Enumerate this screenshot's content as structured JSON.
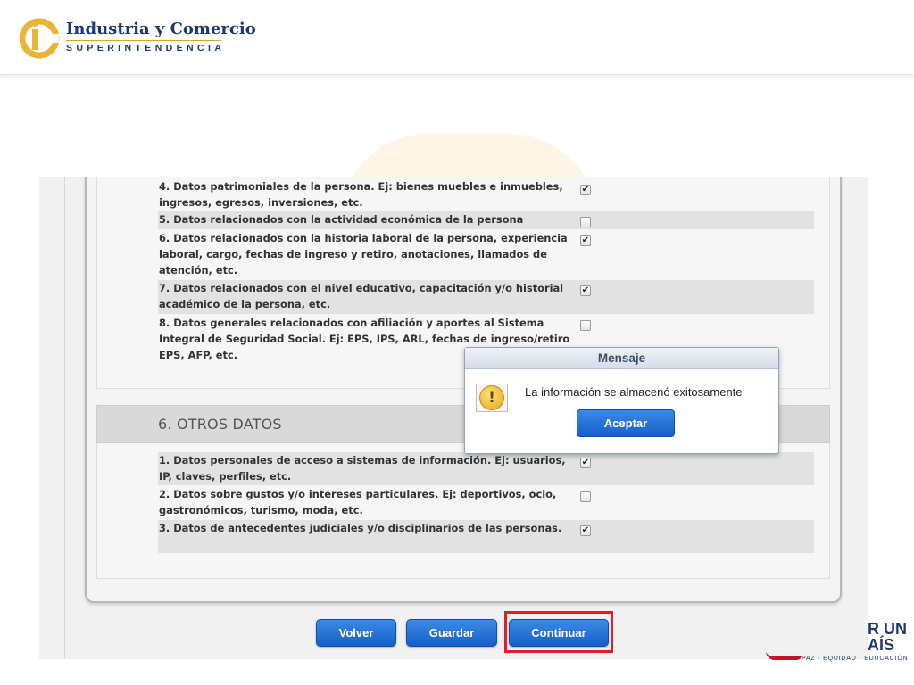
{
  "header": {
    "logo_title": "Industria y Comercio",
    "logo_subtitle": "SUPERINTENDENCIA"
  },
  "section5": {
    "items": [
      {
        "text": "4. Datos patrimoniales de la persona. Ej: bienes muebles e inmuebles, ingresos, egresos, inversiones, etc.",
        "checked": true
      },
      {
        "text": "5. Datos relacionados con la actividad económica de la persona",
        "checked": false
      },
      {
        "text": "6. Datos relacionados con la historia laboral de la persona, experiencia laboral, cargo, fechas de ingreso y retiro, anotaciones, llamados de atención, etc.",
        "checked": true
      },
      {
        "text": "7. Datos relacionados con el nivel educativo, capacitación y/o historial académico de la persona, etc.",
        "checked": true
      },
      {
        "text": "8. Datos generales relacionados con afiliación y aportes al Sistema Integral de Seguridad Social. Ej: EPS, IPS, ARL, fechas de ingreso/retiro EPS, AFP, etc.",
        "checked": false
      }
    ]
  },
  "section6": {
    "title": "6. OTROS DATOS",
    "items": [
      {
        "text": "1. Datos personales de acceso a sistemas de información. Ej: usuarios, IP, claves, perfiles, etc.",
        "checked": true
      },
      {
        "text": "2. Datos sobre gustos y/o intereses particulares. Ej: deportivos, ocio, gastronómicos, turismo, moda, etc.",
        "checked": false
      },
      {
        "text": "3. Datos de antecedentes judiciales y/o disciplinarios de las personas.",
        "checked": true
      }
    ]
  },
  "buttons": {
    "back": "Volver",
    "save": "Guardar",
    "continue": "Continuar"
  },
  "dialog": {
    "title": "Mensaje",
    "message": "La información se almacenó exitosamente",
    "ok": "Aceptar",
    "icon": "warning-icon"
  },
  "footer_logo": {
    "line1": "R UN",
    "line2": "AÍS",
    "tagline": "PAZ · EQUIDAD · EDUCACIÓN"
  },
  "colors": {
    "button_blue": "#1f6fd6",
    "highlight_red": "#e21f26",
    "brand_navy": "#1f3a6e",
    "brand_gold": "#d9a42a"
  }
}
